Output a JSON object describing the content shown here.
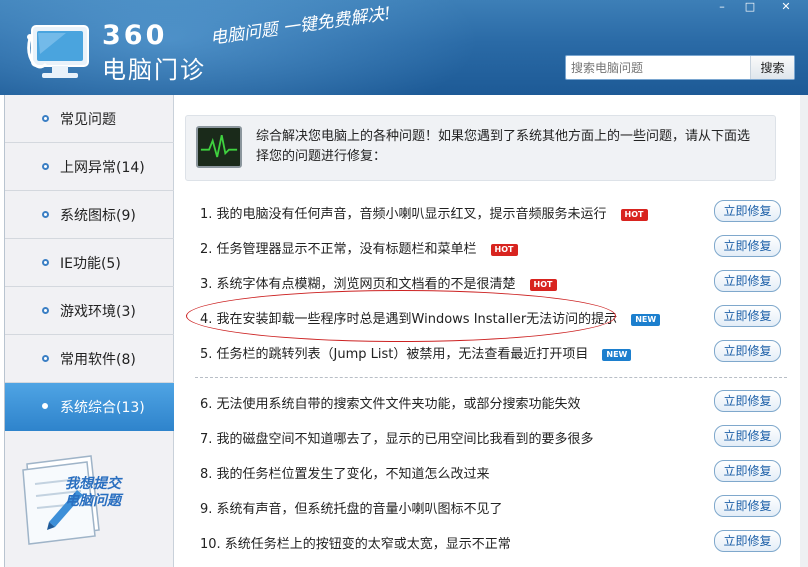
{
  "header": {
    "brand_number": "360",
    "brand_name": "电脑门诊",
    "slogan": "电脑问题 一键免费解决!",
    "window_controls": [
      "–",
      "□",
      "✕"
    ],
    "search": {
      "placeholder": "搜索电脑问题",
      "button_label": "搜索"
    }
  },
  "sidebar": {
    "items": [
      {
        "label": "常见问题",
        "active": false
      },
      {
        "label": "上网异常(14)",
        "active": false
      },
      {
        "label": "系统图标(9)",
        "active": false
      },
      {
        "label": "IE功能(5)",
        "active": false
      },
      {
        "label": "游戏环境(3)",
        "active": false
      },
      {
        "label": "常用软件(8)",
        "active": false
      },
      {
        "label": "系统综合(13)",
        "active": true
      }
    ],
    "submit_label": "我想提交 电脑问题"
  },
  "intro": {
    "text": "综合解决您电脑上的各种问题！如果您遇到了系统其他方面上的一些问题，请从下面选择您的问题进行修复："
  },
  "issues": [
    {
      "text": "1. 我的电脑没有任何声音，音频小喇叭显示红叉，提示音频服务未运行",
      "badge": "HOT"
    },
    {
      "text": "2. 任务管理器显示不正常，没有标题栏和菜单栏",
      "badge": "HOT"
    },
    {
      "text": "3. 系统字体有点模糊，浏览网页和文档看的不是很清楚",
      "badge": "HOT"
    },
    {
      "text": "4. 我在安装卸载一些程序时总是遇到Windows Installer无法访问的提示",
      "badge": "NEW"
    },
    {
      "text": "5. 任务栏的跳转列表（Jump List）被禁用，无法查看最近打开项目",
      "badge": "NEW"
    },
    {
      "text": "6. 无法使用系统自带的搜索文件文件夹功能，或部分搜索功能失效",
      "badge": ""
    },
    {
      "text": "7. 我的磁盘空间不知道哪去了，显示的已用空间比我看到的要多很多",
      "badge": ""
    },
    {
      "text": "8. 我的任务栏位置发生了变化，不知道怎么改过来",
      "badge": ""
    },
    {
      "text": "9. 系统有声音，但系统托盘的音量小喇叭图标不见了",
      "badge": ""
    },
    {
      "text": "10. 系统任务栏上的按钮变的太窄或太宽，显示不正常",
      "badge": ""
    }
  ],
  "fix_button_label": "立即修复",
  "colors": {
    "header": "#2a6aa6",
    "active_nav": "#3a8fd6",
    "hot_badge": "#d8241f",
    "new_badge": "#1c7fce",
    "fix_button_text": "#1d60a8"
  }
}
